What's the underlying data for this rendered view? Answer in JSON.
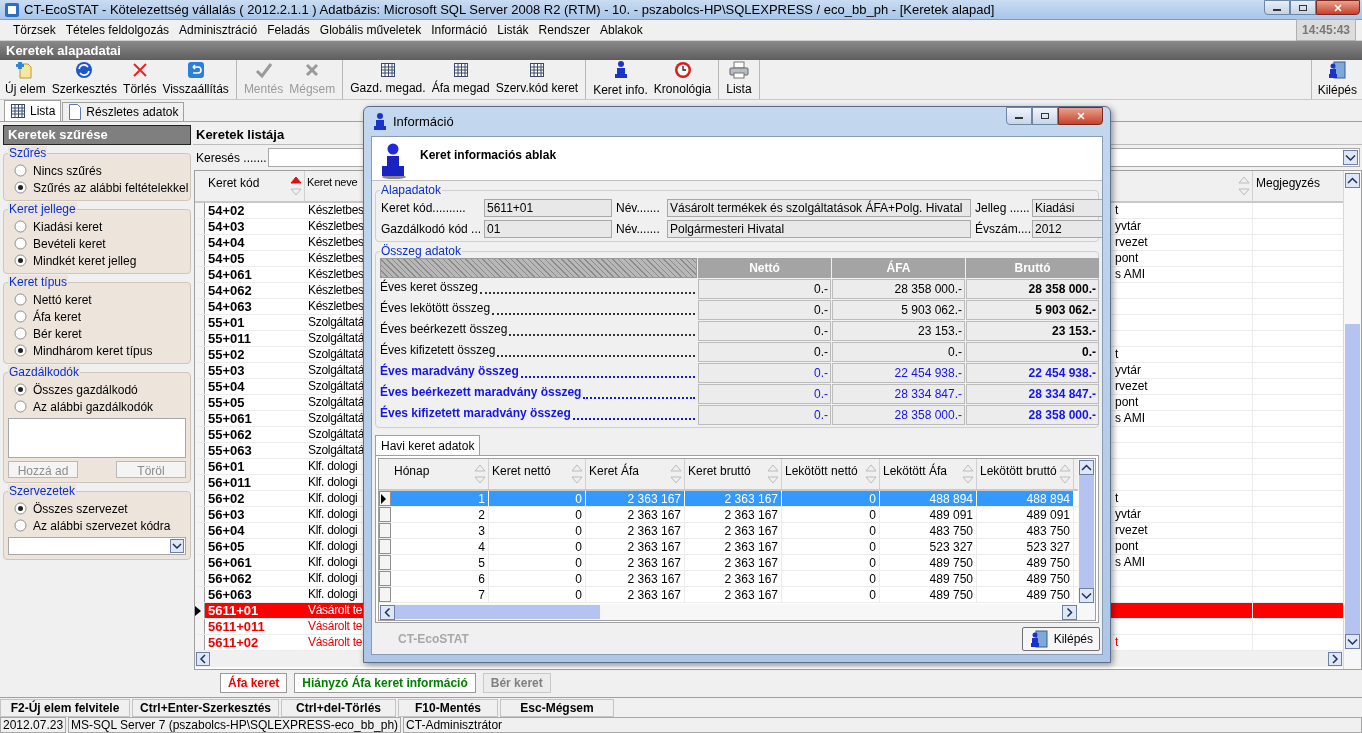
{
  "window": {
    "title": "CT-EcoSTAT - Kötelezettség vállalás ( 2012.2.1.1 ) Adatbázis: Microsoft SQL Server 2008 R2 (RTM) - 10. - pszabolcs-HP\\SQLEXPRESS / eco_bb_ph - [Keretek alapad]",
    "clock": "14:45:43"
  },
  "menu": [
    "Törzsek",
    "Tételes feldolgozás",
    "Adminisztráció",
    "Feladás",
    "Globális műveletek",
    "Információ",
    "Listák",
    "Rendszer",
    "Ablakok"
  ],
  "module_title": "Keretek alapadatai",
  "toolbar": {
    "groups": [
      [
        {
          "label": "Új elem",
          "kind": "new",
          "disabled": false
        },
        {
          "label": "Szerkesztés",
          "kind": "edit",
          "disabled": false
        },
        {
          "label": "Törlés",
          "kind": "delete",
          "disabled": false
        },
        {
          "label": "Visszaállítás",
          "kind": "undo",
          "disabled": false
        }
      ],
      [
        {
          "label": "Mentés",
          "kind": "save",
          "disabled": true
        },
        {
          "label": "Mégsem",
          "kind": "cancel",
          "disabled": true
        }
      ],
      [
        {
          "label": "Gazd. megad.",
          "kind": "grid",
          "disabled": false
        },
        {
          "label": "Áfa megad",
          "kind": "grid",
          "disabled": false
        },
        {
          "label": "Szerv.kód keret",
          "kind": "grid",
          "disabled": false
        }
      ],
      [
        {
          "label": "Keret info.",
          "kind": "person",
          "disabled": false
        },
        {
          "label": "Kronológia",
          "kind": "clock",
          "disabled": false
        }
      ],
      [
        {
          "label": "Lista",
          "kind": "printer",
          "disabled": false
        }
      ]
    ],
    "right": {
      "label": "Kilépés",
      "kind": "exit",
      "disabled": false
    }
  },
  "view_tabs": [
    {
      "label": "Lista",
      "kind": "grid",
      "selected": true
    },
    {
      "label": "Részletes adatok",
      "kind": "page",
      "selected": false
    }
  ],
  "filter_panel": {
    "title": "Keretek szűrése",
    "groups": [
      {
        "title": "Szűrés",
        "kind": "radio",
        "options": [
          {
            "label": "Nincs szűrés",
            "selected": false
          },
          {
            "label": "Szűrés az alábbi feltételekkel",
            "selected": true
          }
        ]
      },
      {
        "title": "Keret jellege",
        "kind": "radio",
        "options": [
          {
            "label": "Kiadási keret",
            "selected": false
          },
          {
            "label": "Bevételi keret",
            "selected": false
          },
          {
            "label": "Mindkét keret jelleg",
            "selected": true
          }
        ]
      },
      {
        "title": "Keret típus",
        "kind": "radio",
        "options": [
          {
            "label": "Nettó keret",
            "selected": false
          },
          {
            "label": "Áfa keret",
            "selected": false
          },
          {
            "label": "Bér keret",
            "selected": false
          },
          {
            "label": "Mindhárom keret típus",
            "selected": true
          }
        ]
      },
      {
        "title": "Gazdálkodók",
        "kind": "list",
        "options": [
          {
            "label": "Összes gazdálkodó",
            "selected": true
          },
          {
            "label": "Az alábbi gazdálkodók",
            "selected": false
          }
        ],
        "buttons": [
          {
            "label": "Hozzá ad",
            "disabled": true
          },
          {
            "label": "Töröl",
            "disabled": true
          }
        ]
      },
      {
        "title": "Szervezetek",
        "kind": "dropdown",
        "options": [
          {
            "label": "Összes szervezet",
            "selected": true
          },
          {
            "label": "Az alábbi szervezet kódra",
            "selected": false
          }
        ]
      }
    ]
  },
  "list": {
    "title": "Keretek listája",
    "search_label": "Keresés .......",
    "columns": [
      "Keret kód",
      "Keret neve",
      "Megjegyzés"
    ],
    "rows": [
      {
        "code": "54+02",
        "name": "Készletbes",
        "column_3": "t",
        "kind": "normal",
        "selected": false
      },
      {
        "code": "54+03",
        "name": "Készletbes",
        "column_3": "yvtár",
        "kind": "normal",
        "selected": false
      },
      {
        "code": "54+04",
        "name": "Készletbes",
        "column_3": "rvezet",
        "kind": "normal",
        "selected": false
      },
      {
        "code": "54+05",
        "name": "Készletbes",
        "column_3": "pont",
        "kind": "normal",
        "selected": false
      },
      {
        "code": "54+061",
        "name": "Készletbes",
        "column_3": "s AMI",
        "kind": "normal",
        "selected": false
      },
      {
        "code": "54+062",
        "name": "Készletbes",
        "kind": "normal",
        "selected": false
      },
      {
        "code": "54+063",
        "name": "Készletbes",
        "kind": "normal",
        "selected": false
      },
      {
        "code": "55+01",
        "name": "Szolgáltatá",
        "kind": "normal",
        "selected": false
      },
      {
        "code": "55+011",
        "name": "Szolgáltatá",
        "kind": "normal",
        "selected": false
      },
      {
        "code": "55+02",
        "name": "Szolgáltatá",
        "column_3": "t",
        "kind": "normal",
        "selected": false
      },
      {
        "code": "55+03",
        "name": "Szolgáltatá",
        "column_3": "yvtár",
        "kind": "normal",
        "selected": false
      },
      {
        "code": "55+04",
        "name": "Szolgáltatá",
        "column_3": "rvezet",
        "kind": "normal",
        "selected": false
      },
      {
        "code": "55+05",
        "name": "Szolgáltatá",
        "column_3": "pont",
        "kind": "normal",
        "selected": false
      },
      {
        "code": "55+061",
        "name": "Szolgáltatá",
        "column_3": "s AMI",
        "kind": "normal",
        "selected": false
      },
      {
        "code": "55+062",
        "name": "Szolgáltatá",
        "kind": "normal",
        "selected": false
      },
      {
        "code": "55+063",
        "name": "Szolgáltatá",
        "kind": "normal",
        "selected": false
      },
      {
        "code": "56+01",
        "name": "Klf. dologi",
        "kind": "normal",
        "selected": false
      },
      {
        "code": "56+011",
        "name": "Klf. dologi",
        "kind": "normal",
        "selected": false
      },
      {
        "code": "56+02",
        "name": "Klf. dologi",
        "column_3": "t",
        "kind": "normal",
        "selected": false
      },
      {
        "code": "56+03",
        "name": "Klf. dologi",
        "column_3": "yvtár",
        "kind": "normal",
        "selected": false
      },
      {
        "code": "56+04",
        "name": "Klf. dologi",
        "column_3": "rvezet",
        "kind": "normal",
        "selected": false
      },
      {
        "code": "56+05",
        "name": "Klf. dologi",
        "column_3": "pont",
        "kind": "normal",
        "selected": false
      },
      {
        "code": "56+061",
        "name": "Klf. dologi",
        "column_3": "s AMI",
        "kind": "normal",
        "selected": false
      },
      {
        "code": "56+062",
        "name": "Klf. dologi",
        "kind": "normal",
        "selected": false
      },
      {
        "code": "56+063",
        "name": "Klf. dologi",
        "kind": "normal",
        "selected": false
      },
      {
        "code": "5611+01",
        "name": "Vásárolt te",
        "kind": "red",
        "selected": true
      },
      {
        "code": "5611+011",
        "name": "Vásárolt te",
        "kind": "red",
        "selected": false
      },
      {
        "code": "5611+02",
        "name": "Vásárolt te",
        "column_3": "t",
        "kind": "red",
        "selected": false
      }
    ]
  },
  "bottom_buttons": [
    {
      "label": "Áfa keret",
      "color": "#ee0000",
      "disabled": false
    },
    {
      "label": "Hiányzó Áfa keret információ",
      "color": "#008000",
      "disabled": false
    },
    {
      "label": "Bér keret",
      "color": "#808080",
      "disabled": true
    }
  ],
  "shortcuts": [
    "F2-Új elem felvitele",
    "Ctrl+Enter-Szerkesztés",
    "Ctrl+del-Törlés",
    "F10-Mentés",
    "Esc-Mégsem"
  ],
  "status_bar": [
    "2012.07.23",
    "MS-SQL Server 7 (pszabolcs-HP\\SQLEXPRESS-eco_bb_ph)",
    "CT-Adminisztrátor"
  ],
  "dialog": {
    "title": "Információ",
    "header": "Keret informaciós ablak",
    "basic": {
      "title": "Alapadatok",
      "rows": [
        [
          {
            "label": "Keret kód..........",
            "value": "5611+01"
          },
          {
            "label": "Név.......",
            "value": "Vásárolt termékek és szolgáltatások ÁFA+Polg. Hivatal"
          },
          {
            "label": "Jelleg ......",
            "value": "Kiadási"
          }
        ],
        [
          {
            "label": "Gazdálkodó kód ...",
            "value": "01"
          },
          {
            "label": "Név.......",
            "value": "Polgármesteri Hivatal"
          },
          {
            "label": "Évszám....",
            "value": "2012"
          }
        ]
      ]
    },
    "totals": {
      "title": "Összeg adatok",
      "columns": [
        "Nettó",
        "ÁFA",
        "Bruttó"
      ],
      "rows": [
        {
          "label": "Éves keret összeg",
          "values": [
            "0.-",
            "28 358 000.-",
            "28 358 000.-"
          ],
          "kind": "normal"
        },
        {
          "label": "Éves lekötött összeg",
          "values": [
            "0.-",
            "5 903 062.-",
            "5 903 062.-"
          ],
          "kind": "normal"
        },
        {
          "label": "Éves beérkezett összeg",
          "values": [
            "0.-",
            "23 153.-",
            "23 153.-"
          ],
          "kind": "normal"
        },
        {
          "label": "Éves kifizetett összeg",
          "values": [
            "0.-",
            "0.-",
            "0.-"
          ],
          "kind": "normal"
        },
        {
          "label": "Éves maradvány összeg",
          "values": [
            "0.-",
            "22 454 938.-",
            "22 454 938.-"
          ],
          "kind": "remainder"
        },
        {
          "label": "Éves beérkezett maradvány összeg",
          "values": [
            "0.-",
            "28 334 847.-",
            "28 334 847.-"
          ],
          "kind": "remainder"
        },
        {
          "label": "Éves kifizetett maradvány összeg",
          "values": [
            "0.-",
            "28 358 000.-",
            "28 358 000.-"
          ],
          "kind": "remainder"
        }
      ]
    },
    "monthly": {
      "tab": "Havi keret adatok",
      "columns": [
        "Hónap",
        "Keret nettó",
        "Keret Áfa",
        "Keret bruttó",
        "Lekötött nettó",
        "Lekötött Áfa",
        "Lekötött bruttó"
      ],
      "rows": [
        {
          "cells": [
            "1",
            "0",
            "2 363 167",
            "2 363 167",
            "0",
            "488 894",
            "488 894"
          ],
          "selected": true
        },
        {
          "cells": [
            "2",
            "0",
            "2 363 167",
            "2 363 167",
            "0",
            "489 091",
            "489 091"
          ],
          "selected": false
        },
        {
          "cells": [
            "3",
            "0",
            "2 363 167",
            "2 363 167",
            "0",
            "483 750",
            "483 750"
          ],
          "selected": false
        },
        {
          "cells": [
            "4",
            "0",
            "2 363 167",
            "2 363 167",
            "0",
            "523 327",
            "523 327"
          ],
          "selected": false
        },
        {
          "cells": [
            "5",
            "0",
            "2 363 167",
            "2 363 167",
            "0",
            "489 750",
            "489 750"
          ],
          "selected": false
        },
        {
          "cells": [
            "6",
            "0",
            "2 363 167",
            "2 363 167",
            "0",
            "489 750",
            "489 750"
          ],
          "selected": false
        },
        {
          "cells": [
            "7",
            "0",
            "2 363 167",
            "2 363 167",
            "0",
            "489 750",
            "489 750"
          ],
          "selected": false
        }
      ]
    },
    "footer": "CT-EcoSTAT",
    "exit_button": "Kilépés"
  }
}
